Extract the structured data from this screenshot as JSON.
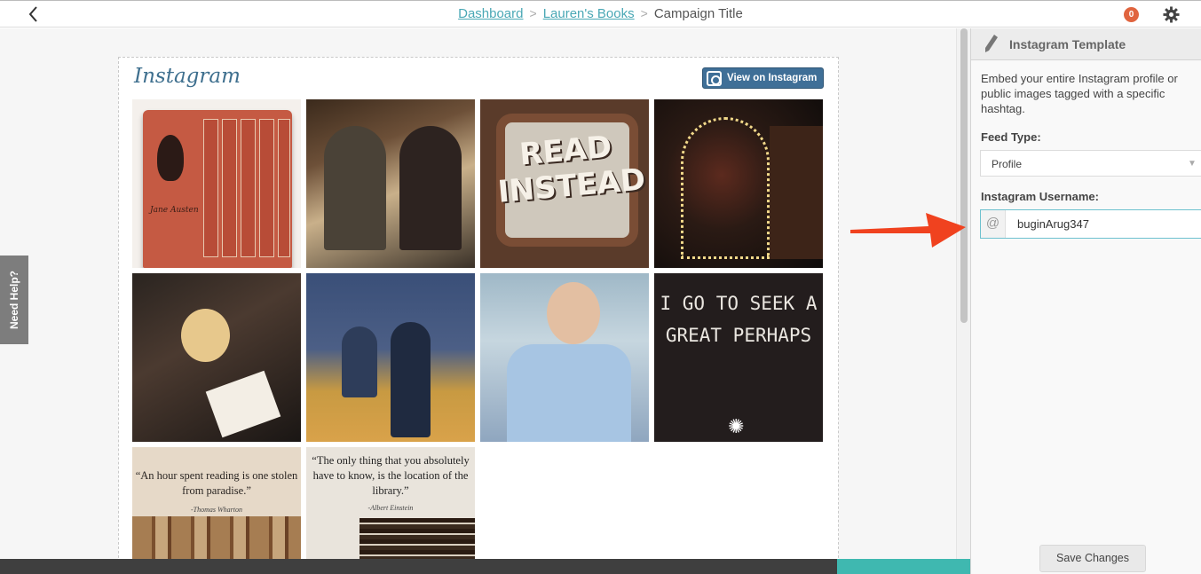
{
  "breadcrumb": {
    "items": [
      "Dashboard",
      "Lauren's Books"
    ],
    "current": "Campaign Title"
  },
  "header": {
    "notification_count": "0"
  },
  "sidebar_tab": {
    "need_help": "Need Help?"
  },
  "feed": {
    "logo": "Instagram",
    "view_button": "View on Instagram",
    "tiles": [
      {
        "sig": "Jane Austen"
      },
      {},
      {
        "text": "READ INSTEAD"
      },
      {},
      {},
      {},
      {},
      {
        "text": "I GO TO SEEK A GREAT PERHAPS"
      },
      {
        "quote": "“An hour spent reading is one stolen from paradise.”",
        "author": "-Thomas Wharton"
      },
      {
        "quote": "“The only thing that you absolutely have to know, is the location of the library.”",
        "author": "-Albert Einstein"
      }
    ]
  },
  "panel": {
    "title": "Instagram Template",
    "description": "Embed your entire Instagram profile or public images tagged with a specific hashtag.",
    "feed_type_label": "Feed Type:",
    "feed_type_value": "Profile",
    "username_label": "Instagram Username:",
    "username_prefix": "@",
    "username_value": "buginArug347",
    "save_button": "Save Changes"
  },
  "colors": {
    "accent": "#4aa8b5",
    "notification": "#e0643f",
    "annotation_arrow": "#f0421f",
    "button_blue": "#3f6f97"
  },
  "icons": [
    "back-chevron-icon",
    "gear-icon",
    "pencil-icon",
    "instagram-camera-icon",
    "dropdown-arrow-icon",
    "at-sign-icon"
  ]
}
